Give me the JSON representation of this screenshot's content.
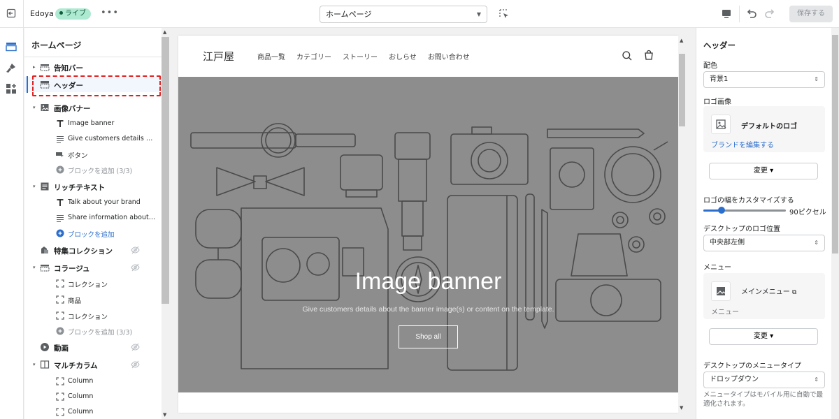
{
  "topbar": {
    "store_name": "Edoya",
    "status_badge": "ライブ",
    "more_label": "•••",
    "template_select": "ホームページ",
    "save_label": "保存する"
  },
  "sidebar": {
    "title": "ホームページ",
    "items": [
      {
        "kind": "section",
        "label": "告知バー",
        "icon": "announcement-bar-icon",
        "caret": "▸"
      },
      {
        "kind": "section",
        "label": "ヘッダー",
        "icon": "header-icon",
        "caret": "",
        "selected": true
      },
      {
        "kind": "section",
        "label": "画像バナー",
        "icon": "image-icon",
        "caret": "▾"
      },
      {
        "kind": "block",
        "label": "Image banner",
        "icon": "text-icon"
      },
      {
        "kind": "block",
        "label": "Give customers details abo...",
        "icon": "paragraph-icon"
      },
      {
        "kind": "block",
        "label": "ボタン",
        "icon": "button-icon"
      },
      {
        "kind": "block-muted",
        "label": "ブロックを追加 (3/3)",
        "icon": "add-circle-icon"
      },
      {
        "kind": "section",
        "label": "リッチテキスト",
        "icon": "rich-text-icon",
        "caret": "▾"
      },
      {
        "kind": "block",
        "label": "Talk about your brand",
        "icon": "text-icon"
      },
      {
        "kind": "block",
        "label": "Share information about yo...",
        "icon": "paragraph-icon"
      },
      {
        "kind": "block-link",
        "label": "ブロックを追加",
        "icon": "add-circle-icon"
      },
      {
        "kind": "section",
        "label": "特集コレクション",
        "icon": "collection-icon",
        "caret": "",
        "hidden": true
      },
      {
        "kind": "section",
        "label": "コラージュ",
        "icon": "collage-icon",
        "caret": "▾",
        "hidden": true
      },
      {
        "kind": "block",
        "label": "コレクション",
        "icon": "frame-icon"
      },
      {
        "kind": "block",
        "label": "商品",
        "icon": "frame-icon"
      },
      {
        "kind": "block",
        "label": "コレクション",
        "icon": "frame-icon"
      },
      {
        "kind": "block-muted",
        "label": "ブロックを追加 (3/3)",
        "icon": "add-circle-icon"
      },
      {
        "kind": "section",
        "label": "動画",
        "icon": "video-icon",
        "caret": "",
        "hidden": true
      },
      {
        "kind": "section",
        "label": "マルチカラム",
        "icon": "columns-icon",
        "caret": "▾",
        "hidden": true
      },
      {
        "kind": "block",
        "label": "Column",
        "icon": "frame-icon"
      },
      {
        "kind": "block",
        "label": "Column",
        "icon": "frame-icon"
      },
      {
        "kind": "block",
        "label": "Column",
        "icon": "frame-icon"
      }
    ]
  },
  "preview": {
    "logo": "江戸屋",
    "nav": [
      "商品一覧",
      "カテゴリー",
      "ストーリー",
      "おしらせ",
      "お問い合わせ"
    ],
    "banner_title": "Image banner",
    "banner_text": "Give customers details about the banner image(s) or content on the template.",
    "banner_button": "Shop all"
  },
  "settings": {
    "title": "ヘッダー",
    "color_label": "配色",
    "color_value": "背景1",
    "logo_label": "ロゴ画像",
    "logo_card_title": "デフォルトのロゴ",
    "logo_card_link": "ブランドを編集する",
    "change_label": "変更",
    "logo_width_label": "ロゴの幅をカスタマイズする",
    "logo_width_value": "90ピクセル",
    "logo_width_fraction": 0.22,
    "logo_position_label": "デスクトップのロゴ位置",
    "logo_position_value": "中央部左側",
    "menu_label": "メニュー",
    "menu_card_title": "メインメニュー",
    "menu_card_sub": "メニュー",
    "menu_type_label": "デスクトップのメニュータイプ",
    "menu_type_value": "ドロップダウン",
    "menu_help": "メニュータイプはモバイル用に自動で最適化されます。"
  },
  "colors": {
    "accent": "#2c6ecb",
    "badge_bg": "#aee9d1",
    "highlight_dash": "#e02020",
    "banner_overlay": "#8d8d8d"
  }
}
